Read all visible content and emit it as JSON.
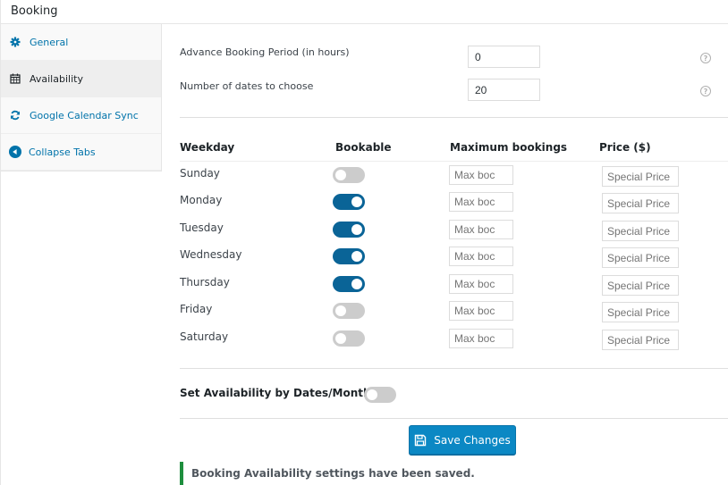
{
  "header": {
    "title": "Booking"
  },
  "sidebar": {
    "tabs": [
      {
        "label": "General",
        "icon": "gear-icon",
        "active": false
      },
      {
        "label": "Availability",
        "icon": "calendar-icon",
        "active": true
      },
      {
        "label": "Google Calendar Sync",
        "icon": "sync-icon",
        "active": false
      },
      {
        "label": "Collapse Tabs",
        "icon": "collapse-arrow-icon",
        "active": false
      }
    ]
  },
  "settings": {
    "advance_booking": {
      "label": "Advance Booking Period (in hours)",
      "value": "0",
      "help_icon": "help-icon"
    },
    "number_of_dates": {
      "label": "Number of dates to choose",
      "value": "20",
      "help_icon": "help-icon"
    }
  },
  "weekday_table": {
    "headers": {
      "weekday": "Weekday",
      "bookable": "Bookable",
      "max": "Maximum bookings",
      "price": "Price ($)"
    },
    "rows": [
      {
        "day": "Sunday",
        "bookable": false,
        "max_placeholder": "Max boc",
        "price_placeholder": "Special Price"
      },
      {
        "day": "Monday",
        "bookable": true,
        "max_placeholder": "Max boc",
        "price_placeholder": "Special Price"
      },
      {
        "day": "Tuesday",
        "bookable": true,
        "max_placeholder": "Max boc",
        "price_placeholder": "Special Price"
      },
      {
        "day": "Wednesday",
        "bookable": true,
        "max_placeholder": "Max boc",
        "price_placeholder": "Special Price"
      },
      {
        "day": "Thursday",
        "bookable": true,
        "max_placeholder": "Max boc",
        "price_placeholder": "Special Price"
      },
      {
        "day": "Friday",
        "bookable": false,
        "max_placeholder": "Max boc",
        "price_placeholder": "Special Price"
      },
      {
        "day": "Saturday",
        "bookable": false,
        "max_placeholder": "Max boc",
        "price_placeholder": "Special Price"
      }
    ]
  },
  "availability_by_dates": {
    "label": "Set Availability by Dates/Months",
    "enabled": false
  },
  "save_button": {
    "label": "Save Changes",
    "icon": "floppy-disk-icon"
  },
  "notice": {
    "text": "Booking Availability settings have been saved.",
    "color": "#1e8e3e"
  },
  "colors": {
    "accent": "#0a6497",
    "button": "#0b88c4",
    "link": "#0073aa"
  }
}
